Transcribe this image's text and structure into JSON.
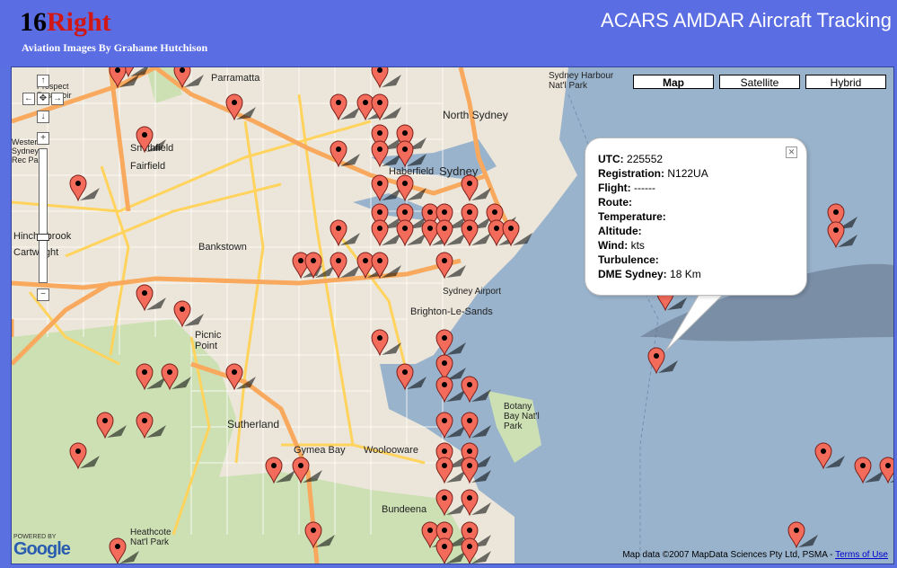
{
  "logo": {
    "part1": "16",
    "part2": "Right",
    "tagline": "Aviation Images By Grahame Hutchison"
  },
  "site_title": "ACARS AMDAR Aircraft Tracking",
  "map_types": [
    "Map",
    "Satellite",
    "Hybrid"
  ],
  "active_map_type": "Map",
  "info": {
    "utc_label": "UTC:",
    "utc": "225552",
    "reg_label": "Registration:",
    "reg": "N122UA",
    "flight_label": "Flight:",
    "flight": "------",
    "route_label": "Route:",
    "route": "",
    "temp_label": "Temperature:",
    "temp": "",
    "alt_label": "Altitude:",
    "alt": "",
    "wind_label": "Wind:",
    "wind": "kts",
    "turb_label": "Turbulence:",
    "turb": "",
    "dme_label": "DME Sydney:",
    "dme": "18 Km"
  },
  "places": [
    "Parramatta",
    "North Sydney",
    "Sydney",
    "Haberfield",
    "Smithfield",
    "Fairfield",
    "Bankstown",
    "Hinchinbrook",
    "Cartwright",
    "Picnic Point",
    "Brighton-Le-Sands",
    "Sydney Airport",
    "Botany Bay Nat'l Park",
    "Sutherland",
    "Gymea Bay",
    "Woolooware",
    "Bundeena",
    "Heathcote Nat'l Park",
    "Sydney Harbour Nat'l Park",
    "Prospect Reservoir",
    "Western Sydney Rec Park"
  ],
  "map_google": {
    "powered": "POWERED BY",
    "logo": "Google"
  },
  "copyright": {
    "text": "Map data ©2007 MapData Sciences Pty Ltd, PSMA -",
    "link": "Terms of Use"
  },
  "colors": {
    "header": "#5b6de3",
    "marker": "#f26b5b",
    "water": "#99b3cc",
    "land": "#ece6da",
    "park": "#cde0b4",
    "major_road": "#f8a95d",
    "road": "#ffd35c"
  }
}
